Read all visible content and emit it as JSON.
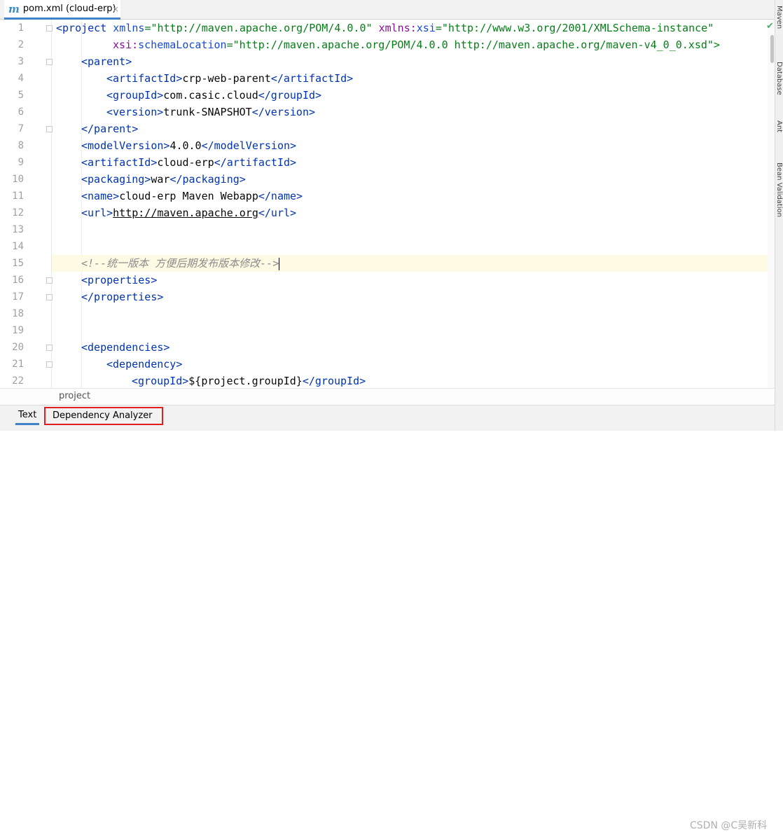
{
  "tab": {
    "icon": "maven-m-icon",
    "icon_glyph": "m",
    "title": "pom.xml (cloud-erp)",
    "close_glyph": "×"
  },
  "line_numbers": [
    "1",
    "2",
    "3",
    "4",
    "5",
    "6",
    "7",
    "8",
    "9",
    "10",
    "11",
    "12",
    "13",
    "14",
    "15",
    "16",
    "17",
    "18",
    "19",
    "20",
    "21",
    "22"
  ],
  "code": {
    "l1_open": "<project ",
    "l1_a1": "xmlns",
    "l1_v1": "=\"http://maven.apache.org/POM/4.0.0\" ",
    "l1_ns": "xmlns:",
    "l1_a2": "xsi",
    "l1_v2": "=\"http://www.w3.org/2001/XMLSchema-instance\"",
    "l2_ns": "xsi:",
    "l2_a": "schemaLocation",
    "l2_v": "=\"http://maven.apache.org/POM/4.0.0 http://maven.apache.org/maven-v4_0_0.xsd\">",
    "parent_open": "<parent>",
    "parent_close": "</parent>",
    "artifact_open": "<artifactId>",
    "artifact_close": "</artifactId>",
    "parent_artifact": "crp-web-parent",
    "group_open": "<groupId>",
    "group_close": "</groupId>",
    "parent_group": "com.casic.cloud",
    "version_open": "<version>",
    "version_close": "</version>",
    "parent_version": "trunk-SNAPSHOT",
    "model_open": "<modelVersion>",
    "model_value": "4.0.0",
    "model_close": "</modelVersion>",
    "artifact_value": "cloud-erp",
    "packaging_open": "<packaging>",
    "packaging_value": "war",
    "packaging_close": "</packaging>",
    "name_open": "<name>",
    "name_value": "cloud-erp Maven Webapp",
    "name_close": "</name>",
    "url_open": "<url>",
    "url_value": "http://maven.apache.org",
    "url_close": "</url>",
    "comment": "<!--统一版本 方便后期发布版本修改-->",
    "props_open": "<properties>",
    "props_close": "</properties>",
    "deps_open": "<dependencies>",
    "dep_open": "<dependency>",
    "dep_group_value": "${project.groupId}"
  },
  "breadcrumb": "project",
  "bottom_tabs": {
    "text": "Text",
    "dependency_analyzer": "Dependency Analyzer"
  },
  "side_panels": [
    "Maven",
    "Database",
    "Ant",
    "Bean Validation"
  ],
  "watermark": "CSDN @C吴新科",
  "colors": {
    "tag": "#0033b3",
    "attr_value": "#067d17",
    "comment": "#8c8c8c",
    "highlight": "#e02020",
    "accent": "#4083c9"
  }
}
